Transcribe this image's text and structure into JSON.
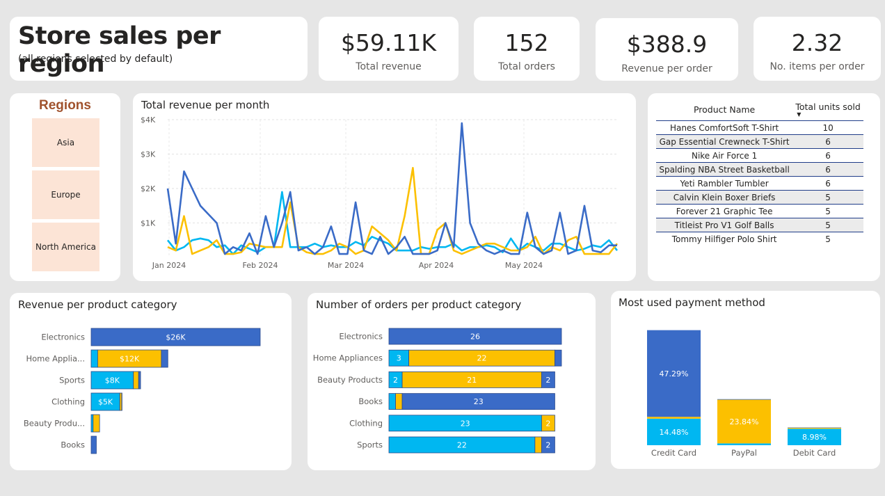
{
  "header": {
    "title": "Store sales per region",
    "subtitle": "(all regions selected by default)"
  },
  "kpis": [
    {
      "value": "$59.11K",
      "label": "Total revenue"
    },
    {
      "value": "152",
      "label": "Total orders"
    },
    {
      "value": "$388.9",
      "label": "Revenue per order"
    },
    {
      "value": "2.32",
      "label": "No. items per order"
    }
  ],
  "regions": {
    "title": "Regions",
    "items": [
      "Asia",
      "Europe",
      "North America"
    ]
  },
  "colors": {
    "dark_blue": "#3a6bc7",
    "light_blue": "#00b7f1",
    "yellow": "#fcc000",
    "accent_text": "#a0522d",
    "slicer_bg": "#fce4d6"
  },
  "products_table": {
    "headers": [
      "Product Name",
      "Total units sold"
    ],
    "rows": [
      [
        "Hanes ComfortSoft T-Shirt",
        "10"
      ],
      [
        "Gap Essential Crewneck T-Shirt",
        "6"
      ],
      [
        "Nike Air Force 1",
        "6"
      ],
      [
        "Spalding NBA Street Basketball",
        "6"
      ],
      [
        "Yeti Rambler Tumbler",
        "6"
      ],
      [
        "Calvin Klein Boxer Briefs",
        "5"
      ],
      [
        "Forever 21 Graphic Tee",
        "5"
      ],
      [
        "Titleist Pro V1 Golf Balls",
        "5"
      ],
      [
        "Tommy Hilfiger Polo Shirt",
        "5"
      ]
    ]
  },
  "chart_data": [
    {
      "type": "line",
      "title": "Total revenue per month",
      "y_ticks": [
        "$1K",
        "$2K",
        "$3K",
        "$4K"
      ],
      "x_ticks": [
        "Jan 2024",
        "Feb 2024",
        "Mar 2024",
        "Apr 2024",
        "May 2024"
      ],
      "ylim": [
        0,
        4000
      ],
      "grid": true,
      "series": [
        {
          "color": "#3a6bc7",
          "values": [
            2000,
            400,
            2500,
            2000,
            1500,
            1250,
            1000,
            100,
            300,
            200,
            700,
            100,
            1200,
            300,
            1000,
            1900,
            200,
            300,
            100,
            300,
            900,
            100,
            100,
            1600,
            200,
            100,
            600,
            100,
            300,
            600,
            100,
            100,
            100,
            200,
            1000,
            300,
            3900,
            1000,
            400,
            200,
            100,
            200,
            100,
            100,
            1300,
            300,
            100,
            200,
            1300,
            100,
            200,
            1500,
            200,
            150,
            350,
            350
          ]
        },
        {
          "color": "#00b7f1",
          "values": [
            500,
            200,
            300,
            500,
            550,
            500,
            300,
            350,
            100,
            350,
            250,
            150,
            300,
            300,
            1900,
            300,
            300,
            300,
            400,
            300,
            350,
            300,
            300,
            450,
            350,
            600,
            500,
            400,
            200,
            200,
            200,
            300,
            250,
            300,
            300,
            400,
            200,
            300,
            300,
            350,
            300,
            150,
            550,
            200,
            400,
            300,
            200,
            400,
            400,
            300,
            200,
            250,
            350,
            300,
            500,
            200
          ]
        },
        {
          "color": "#fcc000",
          "values": [
            300,
            200,
            1200,
            100,
            200,
            300,
            500,
            100,
            100,
            150,
            400,
            350,
            300,
            300,
            300,
            1600,
            300,
            150,
            100,
            100,
            200,
            400,
            300,
            100,
            200,
            900,
            700,
            500,
            200,
            1200,
            2600,
            100,
            100,
            800,
            1000,
            200,
            100,
            200,
            300,
            400,
            400,
            300,
            200,
            200,
            300,
            600,
            100,
            300,
            200,
            500,
            600,
            100,
            100,
            100,
            100,
            400
          ]
        }
      ]
    },
    {
      "type": "bar",
      "orientation": "horizontal-stacked",
      "title": "Revenue per product category",
      "categories": [
        "Electronics",
        "Home Applia...",
        "Sports",
        "Clothing",
        "Beauty Produ...",
        "Books"
      ],
      "series": [
        {
          "color": "#00b7f1",
          "values": [
            0,
            1000,
            6500,
            4400,
            300,
            0
          ]
        },
        {
          "color": "#fcc000",
          "values": [
            0,
            9800,
            800,
            300,
            1000,
            0
          ]
        },
        {
          "color": "#3a6bc7",
          "values": [
            26000,
            1000,
            300,
            50,
            0,
            800
          ]
        }
      ],
      "data_labels": [
        "$26K",
        "$12K",
        "$8K",
        "$5K",
        "",
        ""
      ],
      "xlim": [
        0,
        26000
      ]
    },
    {
      "type": "bar",
      "orientation": "horizontal-stacked",
      "title": "Number of orders per product category",
      "categories": [
        "Electronics",
        "Home Appliances",
        "Beauty Products",
        "Books",
        "Clothing",
        "Sports"
      ],
      "series": [
        {
          "color": "#00b7f1",
          "values": [
            0,
            3,
            2,
            1,
            23,
            22
          ]
        },
        {
          "color": "#fcc000",
          "values": [
            0,
            22,
            21,
            1,
            2,
            1
          ]
        },
        {
          "color": "#3a6bc7",
          "values": [
            26,
            1,
            2,
            23,
            0,
            2
          ]
        }
      ],
      "xlim": [
        0,
        26
      ]
    },
    {
      "type": "bar",
      "orientation": "vertical-stacked",
      "title": "Most used payment method",
      "categories": [
        "Credit Card",
        "PayPal",
        "Debit Card"
      ],
      "series": [
        {
          "color": "#00b7f1",
          "values": [
            14.48,
            1,
            8.98
          ],
          "labels": [
            "14.48%",
            "",
            "8.98%"
          ]
        },
        {
          "color": "#fcc000",
          "values": [
            1,
            23.84,
            0.5
          ],
          "labels": [
            "",
            "23.84%",
            ""
          ]
        },
        {
          "color": "#3a6bc7",
          "values": [
            47.29,
            0.3,
            0.2
          ],
          "labels": [
            "47.29%",
            "",
            ""
          ]
        }
      ],
      "ylim": [
        0,
        63
      ]
    }
  ]
}
